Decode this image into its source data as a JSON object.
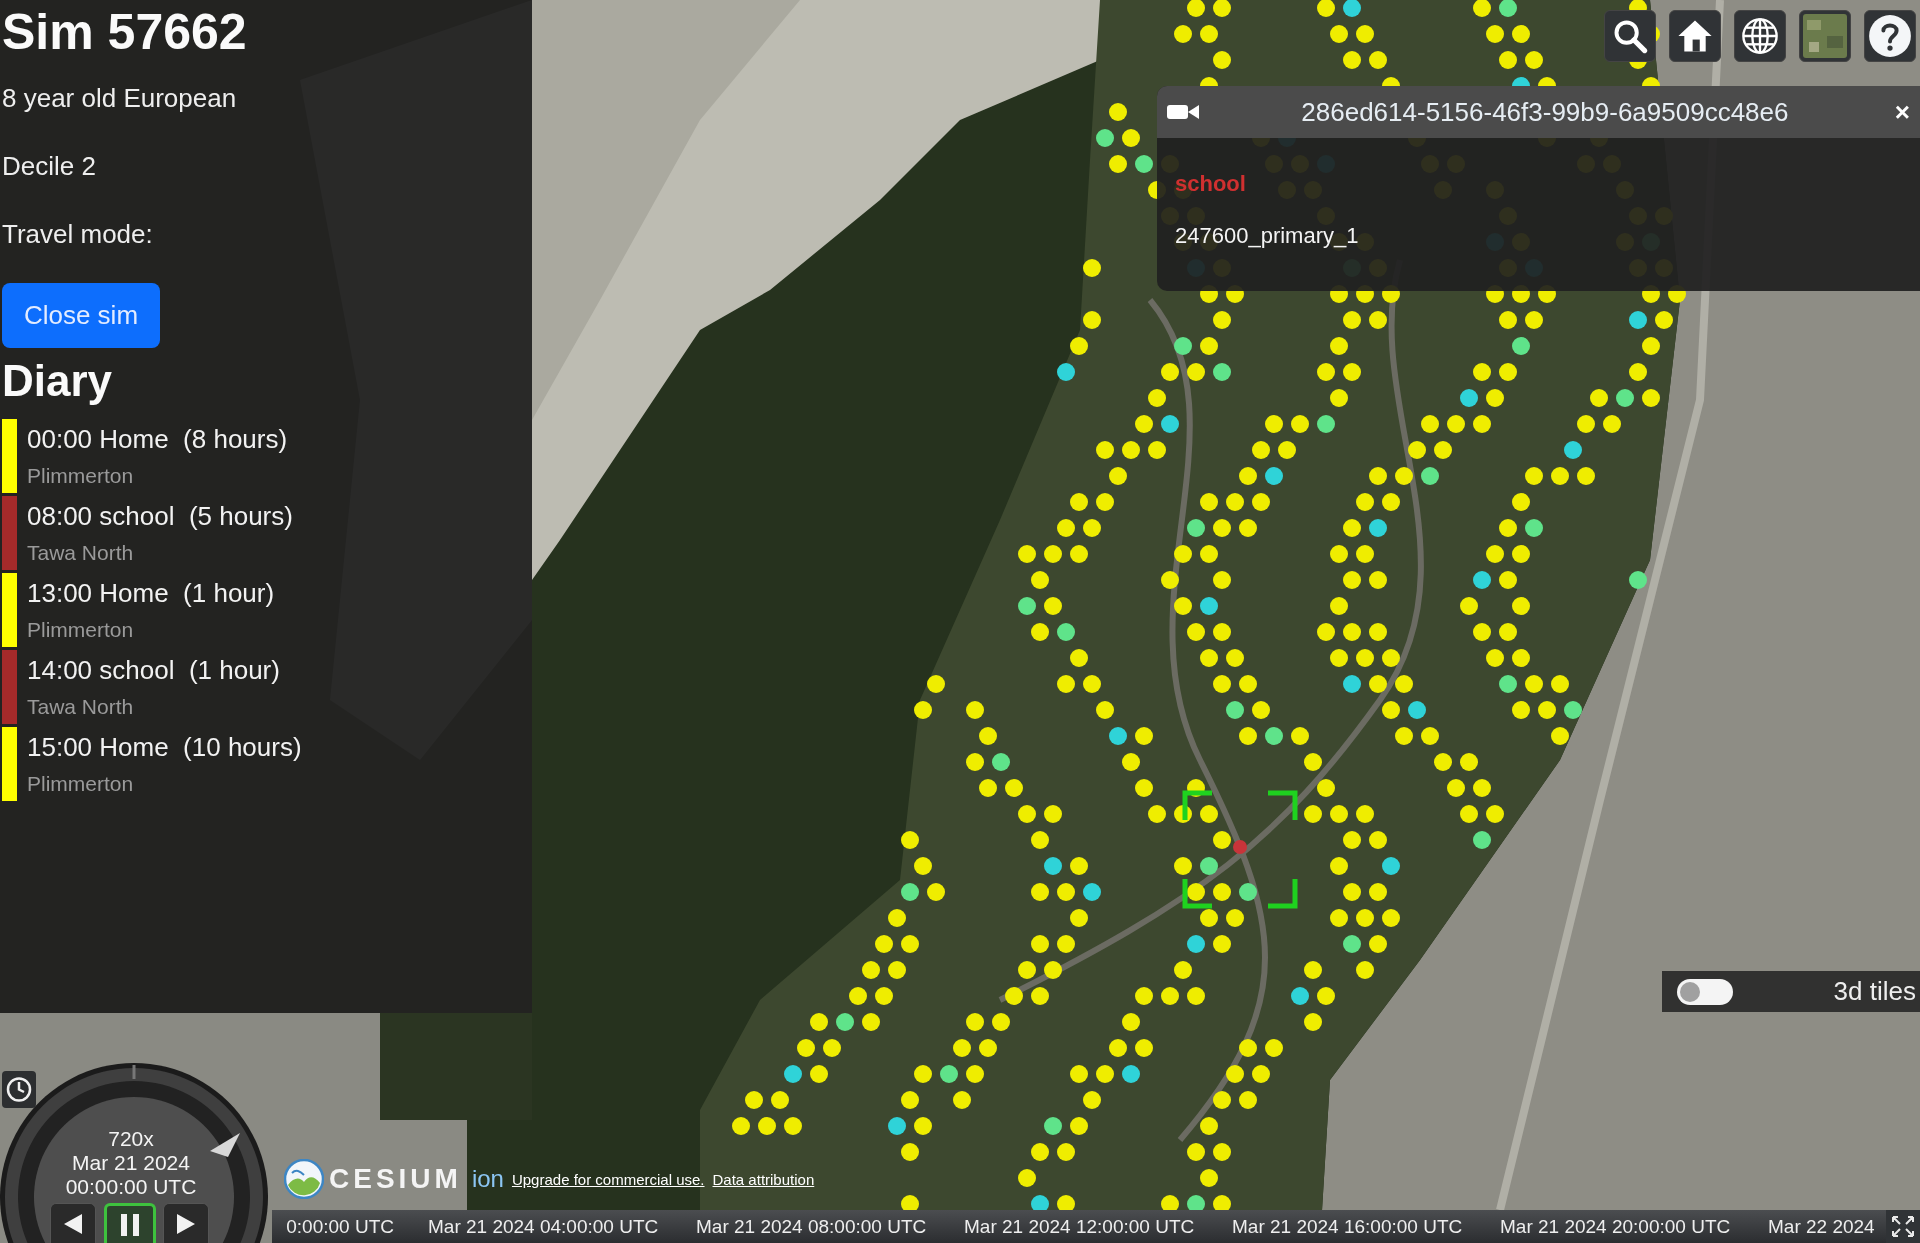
{
  "sim": {
    "title": "Sim 57662",
    "description": "8 year old European",
    "decile": "Decile 2",
    "travel_mode": "Travel mode:",
    "close_button": "Close sim"
  },
  "diary": {
    "heading": "Diary",
    "entries": [
      {
        "label": "00:00 Home  (8 hours)",
        "place": "Plimmerton",
        "color": "#ffff00"
      },
      {
        "label": "08:00 school  (5 hours)",
        "place": "Tawa North",
        "color": "#a52a2a"
      },
      {
        "label": "13:00 Home  (1 hour)",
        "place": "Plimmerton",
        "color": "#ffff00"
      },
      {
        "label": "14:00 school  (1 hour)",
        "place": "Tawa North",
        "color": "#a52a2a"
      },
      {
        "label": "15:00 Home  (10 hours)",
        "place": "Plimmerton",
        "color": "#ffff00"
      }
    ]
  },
  "info_box": {
    "title": "286ed614-5156-46f3-99b9-6a9509cc48e6",
    "close": "×",
    "category": "school",
    "name": "247600_primary_1"
  },
  "tiles_toggle": {
    "label": "3d tiles",
    "on": false
  },
  "clock": {
    "speed": "720x",
    "date": "Mar 21 2024",
    "time": "00:00:00 UTC",
    "paused": true
  },
  "credits": {
    "logo": "CESIUM",
    "logo_suffix": "ion",
    "links": [
      "Upgrade for commercial use.",
      "Data attribution"
    ]
  },
  "timeline": {
    "labels": [
      "0:00:00 UTC",
      "Mar 21 2024 04:00:00 UTC",
      "Mar 21 2024 08:00:00 UTC",
      "Mar 21 2024 12:00:00 UTC",
      "Mar 21 2024 16:00:00 UTC",
      "Mar 21 2024 20:00:00 UTC",
      "Mar 22 2024"
    ]
  }
}
